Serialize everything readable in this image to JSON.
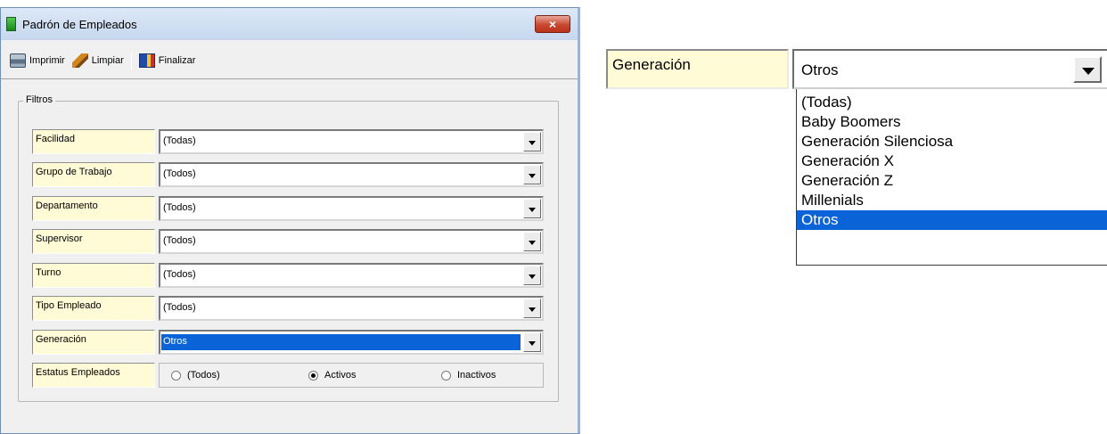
{
  "window": {
    "title": "Padrón de Empleados",
    "close_label": "×"
  },
  "toolbar": {
    "print_label": "Imprimir",
    "clear_label": "Limpiar",
    "finish_label": "Finalizar"
  },
  "filters": {
    "legend": "Filtros",
    "fields": [
      {
        "label": "Facilidad",
        "value": "(Todas)"
      },
      {
        "label": "Grupo de Trabajo",
        "value": "(Todos)"
      },
      {
        "label": "Departamento",
        "value": "(Todos)"
      },
      {
        "label": "Supervisor",
        "value": "(Todos)"
      },
      {
        "label": "Turno",
        "value": "(Todos)"
      },
      {
        "label": "Tipo Empleado",
        "value": "(Todos)"
      },
      {
        "label": "Generación",
        "value": "Otros"
      }
    ],
    "status": {
      "label": "Estatus Empleados",
      "options": [
        "(Todos)",
        "Activos",
        "Inactivos"
      ],
      "selected": "Activos"
    }
  },
  "zoom": {
    "label": "Generación",
    "value": "Otros",
    "options": [
      "(Todas)",
      "Baby Boomers",
      "Generación Silenciosa",
      "Generación X",
      "Generación Z",
      "Millenials",
      "Otros"
    ],
    "highlighted": "Otros"
  }
}
